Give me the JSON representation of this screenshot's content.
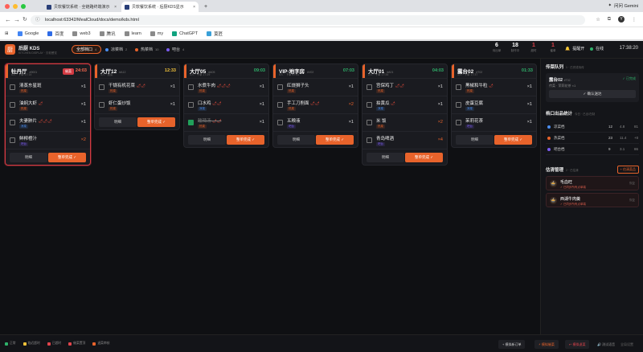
{
  "browser": {
    "tabs": [
      {
        "label": "贝软餐饮系统 · 全链路终端演示"
      },
      {
        "label": "贝软餐饮系统 · 后厨KDS显示"
      }
    ],
    "gemini": "问问 Gemini",
    "url": "localhost:63342/MealCloud/docs/demo/kds.html",
    "bookmarks": [
      "Google",
      "百度",
      "web3",
      "腾讯",
      "learn",
      "my",
      "ChatGPT",
      "莫匠"
    ],
    "avatar": "Y"
  },
  "header": {
    "title": "后厨 KDS",
    "subtitle": "KITCHEN DISPLAY · 贝软餐饮",
    "logo": "厨",
    "filters": [
      {
        "label": "全部档口",
        "count": "4",
        "active": true
      },
      {
        "label": "凉菜档",
        "count": "2",
        "color": "#4b8ef0"
      },
      {
        "label": "热菜档",
        "count": "10",
        "color": "#e8632b"
      },
      {
        "label": "吧台",
        "count": "4",
        "color": "#7b5cf0"
      }
    ],
    "stats": [
      {
        "n": "6",
        "l": "待出单",
        "c": "#ffffff"
      },
      {
        "n": "18",
        "l": "制作中",
        "c": "#ffffff"
      },
      {
        "n": "1",
        "l": "超时",
        "c": "#e0444c"
      },
      {
        "n": "1",
        "l": "催单",
        "c": "#e0444c"
      }
    ],
    "remind": "提醒开",
    "online": "在线",
    "clock": "17:38:20"
  },
  "cards": [
    {
      "table": "牡丹厅",
      "no": "#9001",
      "sub": "5人 · 下单 17:14",
      "time": "24:03",
      "tc": "#ff6a50",
      "badge": "催菜",
      "urgent": true,
      "accent": "#e8632b",
      "items": [
        {
          "name": "清蒸东星斑",
          "tag": "热菜",
          "tagc": "#e8632b",
          "q": "×1"
        },
        {
          "name": "油焖大虾",
          "chili": "🌶",
          "tag": "热菜",
          "tagc": "#e8632b",
          "q": "×1"
        },
        {
          "name": "夫妻肺片",
          "chili": "🌶🌶🌶",
          "tag": "凉菜",
          "tagc": "#4b8ef0",
          "q": "×1"
        },
        {
          "name": "鲜榨橙汁",
          "tag": "吧台",
          "tagc": "#7b5cf0",
          "q": "×2",
          "hi": true
        }
      ],
      "detail": "明细",
      "done": "整单完成 ✓"
    },
    {
      "table": "大厅12",
      "no": "#A12",
      "sub": "4人 · 加菜",
      "time": "12:33",
      "tc": "#f2c23a",
      "accent": "#e8632b",
      "items": [
        {
          "name": "干锅有机花菜",
          "chili": "🌶🌶",
          "tag": "热菜",
          "tagc": "#e8632b",
          "q": "×1"
        },
        {
          "name": "虾仁蛋炒饭",
          "tag": "热菜",
          "tagc": "#e8632b",
          "q": "×1"
        }
      ],
      "detail": "明细",
      "done": "整单完成 ✓"
    },
    {
      "table": "大厅05",
      "no": "#A05",
      "sub": "4人 · 下单 17:29",
      "time": "09:03",
      "tc": "#2fb26a",
      "accent": "#e8632b",
      "items": [
        {
          "name": "水煮牛肉",
          "chili": "🌶🌶🌶",
          "tag": "热菜",
          "tagc": "#e8632b",
          "q": "×1"
        },
        {
          "name": "口水鸡",
          "chili": "🌶🌶",
          "tag": "凉菜",
          "tagc": "#4b8ef0",
          "q": "×1"
        },
        {
          "name": "酸辣汤",
          "chili": "🌶🌶",
          "tag": "热菜",
          "tagc": "#e8632b",
          "q": "×1",
          "done": true
        }
      ],
      "detail": "明细",
      "done": "整单完成 ✓"
    },
    {
      "table": "VIP·地字房",
      "no": "#V02",
      "sub": "8人 · 下单 17:31",
      "time": "07:03",
      "tc": "#2fb26a",
      "accent": "#e8632b",
      "items": [
        {
          "name": "红烧狮子头",
          "tag": "热菜",
          "tagc": "#e8632b",
          "q": "×1"
        },
        {
          "name": "手工刀削面",
          "chili": "🌶🌶",
          "tag": "热菜",
          "tagc": "#e8632b",
          "q": "×2",
          "hi": true
        },
        {
          "name": "五粮液",
          "tag": "吧台",
          "tagc": "#7b5cf0",
          "q": "×1"
        }
      ],
      "detail": "明细",
      "done": "整单完成 ✓"
    },
    {
      "table": "大厅01",
      "no": "#A01",
      "sub": "2人 · 下单 17:34",
      "time": "04:03",
      "tc": "#2fb26a",
      "accent": "#e8632b",
      "items": [
        {
          "name": "宫保鸡丁",
          "chili": "🌶🌶",
          "tag": "热菜",
          "tagc": "#e8632b",
          "q": "×1"
        },
        {
          "name": "拍黄瓜",
          "chili": "🌶",
          "tag": "凉菜",
          "tagc": "#4b8ef0",
          "q": "×1"
        },
        {
          "name": "米 饭",
          "tag": "热菜",
          "tagc": "#e8632b",
          "q": "×2",
          "hi": true
        },
        {
          "name": "青岛啤酒",
          "tag": "吧台",
          "tagc": "#7b5cf0",
          "q": "×4",
          "hi": true
        }
      ],
      "detail": "明细",
      "done": "整单完成 ✓"
    },
    {
      "table": "露台02",
      "no": "#T02",
      "sub": "3人 · 下单 17:37",
      "time": "01:33",
      "tc": "#2fb26a",
      "accent": "#e8632b",
      "items": [
        {
          "name": "黑椒和牛粒",
          "chili": "🌶",
          "tag": "热菜",
          "tagc": "#e8632b",
          "q": "×1"
        },
        {
          "name": "皮蛋豆腐",
          "tag": "凉菜",
          "tagc": "#4b8ef0",
          "q": "×1"
        },
        {
          "name": "茉莉花茶",
          "tag": "吧台",
          "tagc": "#7b5cf0",
          "q": "×1"
        }
      ],
      "detail": "明细",
      "done": "整单完成 ✓"
    }
  ],
  "side": {
    "pass_title": "传菜队列",
    "pass_sub": "1 · 已完成待传",
    "pass": {
      "table": "露台02",
      "no": "#T02",
      "status": "已完成",
      "queue": "传菜 · 茉莉花茶 ×1",
      "btn": "✓ 确认送达"
    },
    "stats_title": "档口出品统计",
    "stats_sub": "今日 · 已出/在制",
    "rows": [
      {
        "n": "凉菜档",
        "c": "#4b8ef0",
        "v1": "12",
        "v2": "4.8",
        "v3": "81"
      },
      {
        "n": "热菜档",
        "c": "#e8632b",
        "v1": "23",
        "v2": "11.4",
        "v3": "+0"
      },
      {
        "n": "吧台档",
        "c": "#7b5cf0",
        "v1": "9",
        "v2": "3.1",
        "v3": "86"
      }
    ],
    "est_title": "估清管理",
    "est_sub": "2 · 已估清",
    "est_btn": "+ 估清菜品",
    "est": [
      {
        "n": "毛血旺",
        "s": "✓ 已同步所有点单端",
        "a": "恢复"
      },
      {
        "n": "西湖牛肉羹",
        "s": "✓ 已同步所有点单端",
        "a": "恢复"
      }
    ]
  },
  "footer": {
    "legend": [
      {
        "l": "正常",
        "c": "#2fb26a"
      },
      {
        "l": "临近超时",
        "c": "#f2c23a"
      },
      {
        "l": "已超时",
        "c": "#e0444c"
      },
      {
        "l": "催菜置顶",
        "c": "#e0444c"
      },
      {
        "l": "退菜审核",
        "c": "#e8632b"
      }
    ],
    "buttons": [
      "+ 模拟新订单",
      "⚡ 模拟催菜",
      "↩ 模拟退菜",
      "🔊 测试语音",
      "清除完成",
      "全局设置"
    ]
  }
}
